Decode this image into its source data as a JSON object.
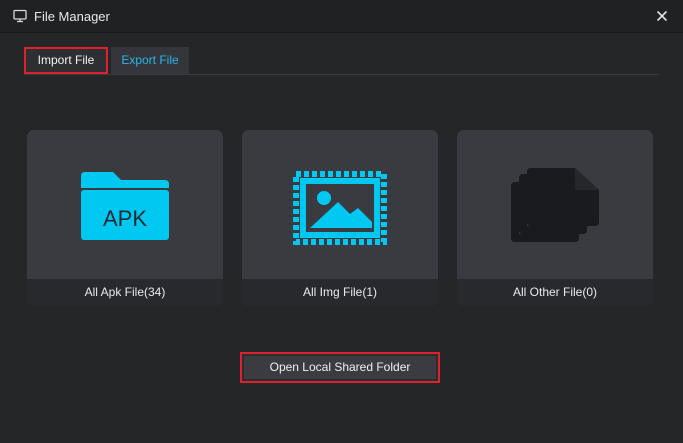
{
  "window": {
    "title": "File Manager"
  },
  "tabs": [
    {
      "label": "Import File",
      "active": true
    },
    {
      "label": "Export File",
      "active": false
    }
  ],
  "cards": [
    {
      "label": "All Apk File(34)",
      "icon": "apk-folder-icon",
      "icon_text": "APK"
    },
    {
      "label": "All Img File(1)",
      "icon": "image-stamp-icon"
    },
    {
      "label": "All Other File(0)",
      "icon": "documents-icon"
    }
  ],
  "actions": {
    "open_shared_folder": "Open Local Shared Folder"
  },
  "colors": {
    "accent": "#00c8f0",
    "tab_export_text": "#29b6e6",
    "highlight_border": "#e0202f",
    "other_icon": "#1a1b1e"
  }
}
